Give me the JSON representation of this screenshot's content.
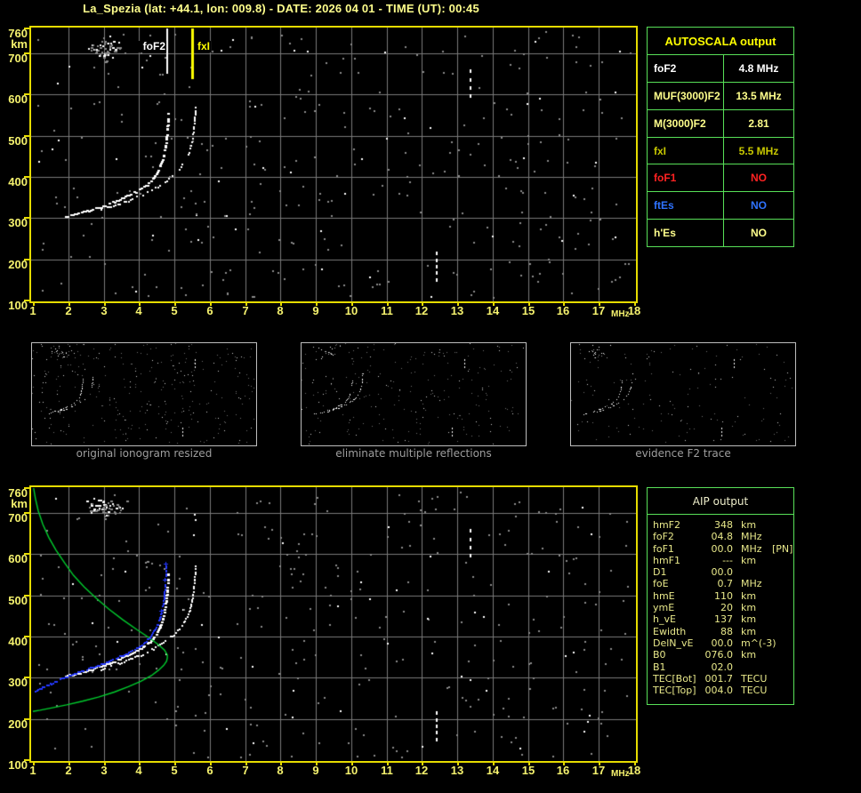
{
  "title": "La_Spezia (lat: +44.1, lon: 009.8) - DATE: 2026 04 01 - TIME (UT): 00:45",
  "colors": {
    "background": "#000000",
    "plot_border": "#e6dc00",
    "axis_labels": "#f5f26e",
    "grid": "#7a7a7a",
    "noise_gray": "#8a8a8a",
    "trace_white": "#ffffff",
    "profile_green": "#00cd2e",
    "restored_blue": "#2438ff",
    "table_border_green": "#58e058",
    "table_yellow": "#ffff8c",
    "table_gold": "#c8c800",
    "table_red": "#ff2222",
    "table_blue": "#2f73ff",
    "caption_gray": "#9e9e9e",
    "title_yellow": "#ffff8c",
    "header_yellow": "#ffff00"
  },
  "autoscala_table": {
    "title": "AUTOSCALA output",
    "rows": [
      {
        "label": "foF2",
        "value": "4.8 MHz",
        "color": "#ffffff"
      },
      {
        "label": "MUF(3000)F2",
        "value": "13.5 MHz",
        "color": "#ffff8c"
      },
      {
        "label": "M(3000)F2",
        "value": "2.81",
        "color": "#ffff8c"
      },
      {
        "label": "fxI",
        "value": "5.5 MHz",
        "color": "#c8c800"
      },
      {
        "label": "foF1",
        "value": "NO",
        "color": "#ff2222"
      },
      {
        "label": "ftEs",
        "value": "NO",
        "color": "#2f73ff"
      },
      {
        "label": "h'Es",
        "value": "NO",
        "color": "#ffff8c"
      }
    ]
  },
  "aip_table": {
    "title": "AIP output",
    "rows": [
      {
        "label": "hmF2",
        "value": "348",
        "unit": "km",
        "note": ""
      },
      {
        "label": "foF2",
        "value": "04.8",
        "unit": "MHz",
        "note": ""
      },
      {
        "label": "foF1",
        "value": "00.0",
        "unit": "MHz",
        "note": "[PN]"
      },
      {
        "label": "hmF1",
        "value": "---",
        "unit": "km",
        "note": ""
      },
      {
        "label": "D1",
        "value": "00.0",
        "unit": "",
        "note": ""
      },
      {
        "label": "foE",
        "value": "0.7",
        "unit": "MHz",
        "note": ""
      },
      {
        "label": "hmE",
        "value": "110",
        "unit": "km",
        "note": ""
      },
      {
        "label": "ymE",
        "value": "20",
        "unit": "km",
        "note": ""
      },
      {
        "label": "h_vE",
        "value": "137",
        "unit": "km",
        "note": ""
      },
      {
        "label": "Ewidth",
        "value": "88",
        "unit": "km",
        "note": ""
      },
      {
        "label": "DelN_vE",
        "value": "00.0",
        "unit": "m^(-3)",
        "note": ""
      },
      {
        "label": "B0",
        "value": "076.0",
        "unit": "km",
        "note": ""
      },
      {
        "label": "B1",
        "value": "02.0",
        "unit": "",
        "note": ""
      },
      {
        "label": "TEC[Bot]",
        "value": "001.7",
        "unit": "TECU",
        "note": ""
      },
      {
        "label": "TEC[Top]",
        "value": "004.0",
        "unit": "TECU",
        "note": ""
      }
    ]
  },
  "panels": [
    {
      "caption": "original ionogram resized",
      "noise_count": 320,
      "seed": 11
    },
    {
      "caption": "eliminate multiple reflections",
      "noise_count": 240,
      "seed": 12
    },
    {
      "caption": "evidence F2 trace",
      "noise_count": 150,
      "seed": 13
    }
  ],
  "chart_data": [
    {
      "id": "autoscaled_ionogram",
      "type": "scatter",
      "title": "",
      "xlabel": "MHz",
      "ylabel": "km",
      "xlim": [
        1,
        18
      ],
      "ylim": [
        100,
        760
      ],
      "x_ticks": [
        1,
        2,
        3,
        4,
        5,
        6,
        7,
        8,
        9,
        10,
        11,
        12,
        13,
        14,
        15,
        16,
        17,
        18
      ],
      "y_ticks": [
        760,
        700,
        600,
        500,
        400,
        300,
        200,
        100
      ],
      "grid": true,
      "markers": [
        {
          "name": "foF2",
          "value_mhz": 4.8,
          "color": "#ffffff"
        },
        {
          "name": "fxI",
          "value_mhz": 5.5,
          "color": "#ffff00"
        }
      ],
      "noise": {
        "seed": 77,
        "count": 340,
        "white_fraction": 0.13
      },
      "noise_cluster": {
        "f": 3.05,
        "km": 712,
        "f_sigma": 0.5,
        "km_sigma": 30,
        "count": 60
      },
      "echo_columns": [
        {
          "f": 13.35,
          "km_from": 600,
          "km_to": 660,
          "n": 4
        },
        {
          "f": 12.4,
          "km_from": 155,
          "km_to": 218,
          "n": 5
        }
      ],
      "series": [
        {
          "name": "F2 trace o-mode",
          "color": "#ffffff",
          "points": [
            [
              1.9,
              305
            ],
            [
              2.1,
              309
            ],
            [
              2.35,
              315
            ],
            [
              2.6,
              321
            ],
            [
              2.9,
              329
            ],
            [
              3.2,
              338
            ],
            [
              3.5,
              349
            ],
            [
              3.8,
              361
            ],
            [
              4.05,
              373
            ],
            [
              4.25,
              386
            ],
            [
              4.4,
              400
            ],
            [
              4.52,
              417
            ],
            [
              4.62,
              437
            ],
            [
              4.69,
              460
            ],
            [
              4.74,
              485
            ],
            [
              4.77,
              510
            ],
            [
              4.79,
              535
            ],
            [
              4.8,
              558
            ]
          ]
        },
        {
          "name": "F2 trace x-mode",
          "color": "#ffffff",
          "points": [
            [
              2.9,
              321
            ],
            [
              3.2,
              329
            ],
            [
              3.5,
              338
            ],
            [
              3.8,
              348
            ],
            [
              4.1,
              359
            ],
            [
              4.4,
              372
            ],
            [
              4.68,
              387
            ],
            [
              4.93,
              403
            ],
            [
              5.13,
              420
            ],
            [
              5.28,
              439
            ],
            [
              5.4,
              461
            ],
            [
              5.47,
              486
            ],
            [
              5.52,
              511
            ],
            [
              5.55,
              536
            ],
            [
              5.57,
              558
            ],
            [
              5.58,
              578
            ]
          ]
        }
      ]
    },
    {
      "id": "ionogram_with_profile",
      "type": "scatter",
      "title": "",
      "xlabel": "MHz",
      "ylabel": "km",
      "xlim": [
        1,
        18
      ],
      "ylim": [
        100,
        760
      ],
      "x_ticks": [
        1,
        2,
        3,
        4,
        5,
        6,
        7,
        8,
        9,
        10,
        11,
        12,
        13,
        14,
        15,
        16,
        17,
        18
      ],
      "y_ticks": [
        760,
        700,
        600,
        500,
        400,
        300,
        200,
        100
      ],
      "grid": true,
      "noise": {
        "seed": 91,
        "count": 340,
        "white_fraction": 0.13
      },
      "noise_cluster": {
        "f": 3.05,
        "km": 712,
        "f_sigma": 0.5,
        "km_sigma": 30,
        "count": 60
      },
      "echo_columns": [
        {
          "f": 13.35,
          "km_from": 600,
          "km_to": 660,
          "n": 4
        },
        {
          "f": 12.4,
          "km_from": 155,
          "km_to": 218,
          "n": 5
        }
      ],
      "series": [
        {
          "name": "F2 trace o-mode",
          "color": "#ffffff",
          "points": [
            [
              1.9,
              305
            ],
            [
              2.1,
              309
            ],
            [
              2.35,
              315
            ],
            [
              2.6,
              321
            ],
            [
              2.9,
              329
            ],
            [
              3.2,
              338
            ],
            [
              3.5,
              349
            ],
            [
              3.8,
              361
            ],
            [
              4.05,
              373
            ],
            [
              4.25,
              386
            ],
            [
              4.4,
              400
            ],
            [
              4.52,
              417
            ],
            [
              4.62,
              437
            ],
            [
              4.69,
              460
            ],
            [
              4.74,
              485
            ],
            [
              4.77,
              510
            ],
            [
              4.79,
              535
            ],
            [
              4.8,
              558
            ]
          ]
        },
        {
          "name": "F2 trace x-mode",
          "color": "#ffffff",
          "points": [
            [
              2.9,
              321
            ],
            [
              3.2,
              329
            ],
            [
              3.5,
              338
            ],
            [
              3.8,
              348
            ],
            [
              4.1,
              359
            ],
            [
              4.4,
              372
            ],
            [
              4.68,
              387
            ],
            [
              4.93,
              403
            ],
            [
              5.13,
              420
            ],
            [
              5.28,
              439
            ],
            [
              5.4,
              461
            ],
            [
              5.47,
              486
            ],
            [
              5.52,
              511
            ],
            [
              5.55,
              536
            ],
            [
              5.57,
              558
            ],
            [
              5.58,
              578
            ]
          ]
        },
        {
          "name": "restored trace",
          "color": "#2438ff",
          "points": [
            [
              1.05,
              268
            ],
            [
              1.3,
              279
            ],
            [
              1.6,
              291
            ],
            [
              1.9,
              302
            ],
            [
              2.2,
              312
            ],
            [
              2.5,
              321
            ],
            [
              2.8,
              330
            ],
            [
              3.1,
              340
            ],
            [
              3.4,
              351
            ],
            [
              3.7,
              363
            ],
            [
              3.95,
              375
            ],
            [
              4.15,
              388
            ],
            [
              4.32,
              403
            ],
            [
              4.45,
              420
            ],
            [
              4.55,
              440
            ],
            [
              4.63,
              463
            ],
            [
              4.68,
              488
            ],
            [
              4.71,
              513
            ],
            [
              4.73,
              538
            ],
            [
              4.74,
              558
            ],
            [
              4.75,
              577
            ]
          ]
        },
        {
          "name": "electron density profile",
          "color": "#00cd2e",
          "points": [
            [
              1.02,
              760
            ],
            [
              1.07,
              735
            ],
            [
              1.15,
              705
            ],
            [
              1.28,
              672
            ],
            [
              1.45,
              640
            ],
            [
              1.65,
              610
            ],
            [
              1.9,
              578
            ],
            [
              2.15,
              548
            ],
            [
              2.45,
              520
            ],
            [
              2.8,
              492
            ],
            [
              3.15,
              466
            ],
            [
              3.55,
              440
            ],
            [
              3.95,
              416
            ],
            [
              4.3,
              396
            ],
            [
              4.55,
              380
            ],
            [
              4.72,
              367
            ],
            [
              4.8,
              355
            ],
            [
              4.8,
              348
            ],
            [
              4.78,
              340
            ],
            [
              4.7,
              330
            ],
            [
              4.55,
              318
            ],
            [
              4.35,
              305
            ],
            [
              4.05,
              291
            ],
            [
              3.7,
              278
            ],
            [
              3.3,
              265
            ],
            [
              2.85,
              253
            ],
            [
              2.4,
              243
            ],
            [
              1.95,
              234
            ],
            [
              1.55,
              227
            ],
            [
              1.2,
              221
            ],
            [
              1.0,
              218
            ]
          ]
        }
      ]
    }
  ]
}
